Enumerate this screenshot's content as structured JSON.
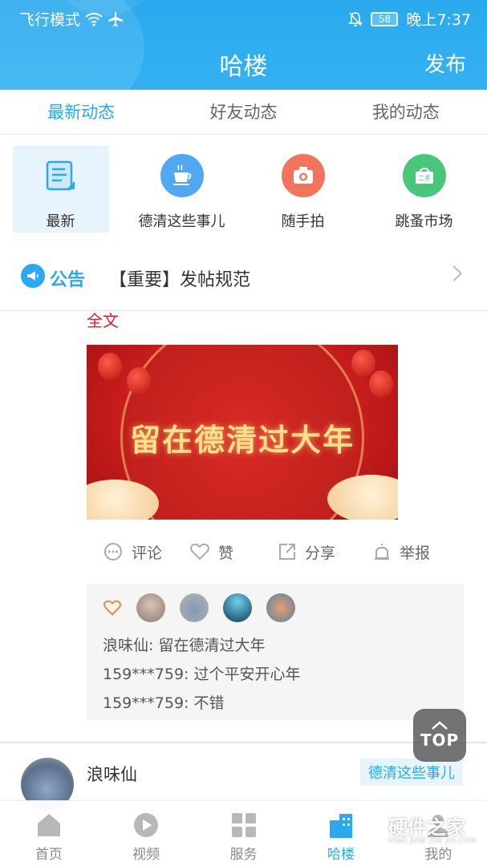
{
  "status_bar": {
    "left_text": "飞行模式",
    "battery": "58",
    "time": "晚上7:37"
  },
  "header": {
    "title": "哈楼",
    "publish": "发布"
  },
  "tabs": [
    {
      "label": "最新动态",
      "active": true
    },
    {
      "label": "好友动态",
      "active": false
    },
    {
      "label": "我的动态",
      "active": false
    }
  ],
  "categories": [
    {
      "label": "最新",
      "icon": "news-icon",
      "color": "#e8f4fd"
    },
    {
      "label": "德清这些事儿",
      "icon": "coffee-cup-icon",
      "color": "#4fa8f0"
    },
    {
      "label": "随手拍",
      "icon": "camera-icon",
      "color": "#f0755a"
    },
    {
      "label": "跳蚤市场",
      "icon": "second-hand-basket-icon",
      "color": "#48c77a"
    }
  ],
  "notice": {
    "tag": "公告",
    "text": "【重要】发帖规范"
  },
  "post": {
    "full_text_link": "全文",
    "banner_text": "留在德清过大年",
    "actions": {
      "comment": "评论",
      "like": "赞",
      "share": "分享",
      "report": "举报"
    },
    "comments": [
      {
        "user": "浪味仙",
        "sep": ": ",
        "text": "留在德清过大年"
      },
      {
        "user": "159***759",
        "sep": ": ",
        "text": "过个平安开心年"
      },
      {
        "user": "159***759",
        "sep": ": ",
        "text": "不错"
      }
    ]
  },
  "next_post": {
    "user": "浪味仙",
    "tag": "德清这些事儿"
  },
  "top_button": "TOP",
  "bottom_nav": [
    {
      "label": "首页",
      "icon": "home-icon",
      "active": false
    },
    {
      "label": "视频",
      "icon": "video-play-icon",
      "active": false
    },
    {
      "label": "服务",
      "icon": "grid-icon",
      "active": false
    },
    {
      "label": "哈楼",
      "icon": "building-icon",
      "active": true
    },
    {
      "label": "我的",
      "icon": "user-icon",
      "active": false
    }
  ],
  "watermark": {
    "line1": "硬件之家",
    "line2": "YING JIAN ZHI JIA.COM"
  },
  "colors": {
    "brand": "#2aa9ee",
    "accent_red": "#d9232d"
  }
}
